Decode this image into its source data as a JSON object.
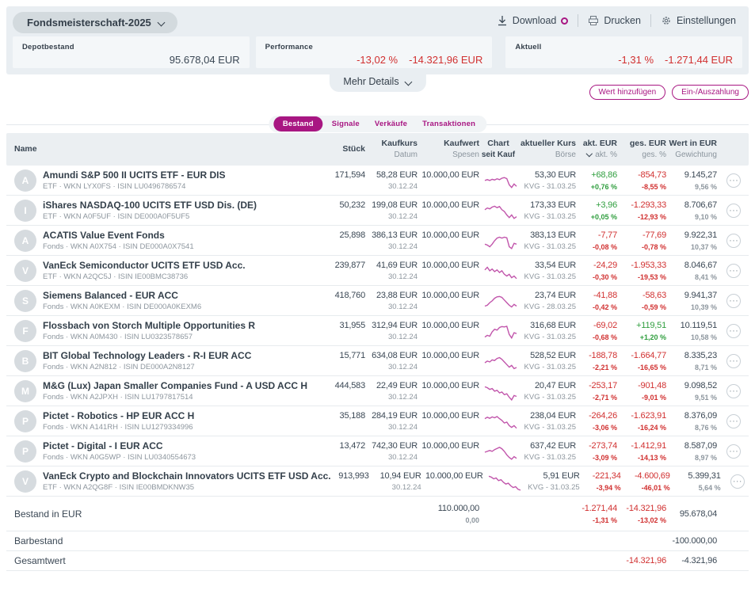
{
  "colors": {
    "brand": "#a81682",
    "red": "#d13030",
    "green": "#2f9e3e",
    "spark": "#c155ab"
  },
  "header": {
    "portfolio_selector": "Fondsmeisterschaft-2025",
    "actions": {
      "download": "Download",
      "print": "Drucken",
      "settings": "Einstellungen"
    },
    "cards": [
      {
        "label": "Depotbestand",
        "values": [
          {
            "text": "95.678,04 EUR",
            "tone": ""
          }
        ]
      },
      {
        "label": "Performance",
        "values": [
          {
            "text": "-13,02 %",
            "tone": "neg"
          },
          {
            "text": "-14.321,96 EUR",
            "tone": "neg"
          }
        ]
      },
      {
        "label": "Aktuell",
        "values": [
          {
            "text": "-1,31 %",
            "tone": "neg"
          },
          {
            "text": "-1.271,44 EUR",
            "tone": "neg"
          }
        ]
      }
    ],
    "more_details": "Mehr Details"
  },
  "toolbar": {
    "add_value": "Wert hinzufügen",
    "deposit": "Ein-/Auszahlung"
  },
  "tabs": [
    {
      "label": "Bestand",
      "active": true
    },
    {
      "label": "Signale",
      "active": false
    },
    {
      "label": "Verkäufe",
      "active": false
    },
    {
      "label": "Transaktionen",
      "active": false
    }
  ],
  "table": {
    "columns": [
      {
        "id": "name",
        "l1": "Name",
        "l2": "",
        "align": "left"
      },
      {
        "id": "stueck",
        "l1": "Stück",
        "l2": "",
        "align": "right"
      },
      {
        "id": "kaufkurs",
        "l1": "Kaufkurs",
        "l2": "Datum",
        "align": "right"
      },
      {
        "id": "kaufwert",
        "l1": "Kaufwert",
        "l2": "Spesen",
        "align": "right"
      },
      {
        "id": "chart",
        "l1": "Chart",
        "l2": "seit Kauf",
        "align": "center",
        "bold2": true
      },
      {
        "id": "kurs",
        "l1": "aktueller Kurs",
        "l2": "Börse",
        "align": "right"
      },
      {
        "id": "akt",
        "l1": "akt. EUR",
        "l2": "akt. %",
        "align": "right",
        "sort": true
      },
      {
        "id": "ges",
        "l1": "ges. EUR",
        "l2": "ges. %",
        "align": "right"
      },
      {
        "id": "wert",
        "l1": "Wert in EUR",
        "l2": "Gewichtung",
        "align": "right"
      },
      {
        "id": "opts",
        "l1": "",
        "l2": "",
        "align": "center"
      }
    ],
    "rows": [
      {
        "initial": "A",
        "name": "Amundi S&P 500 II UCITS ETF - EUR DIS",
        "sub": "ETF · WKN LYX0FS · ISIN LU0496786574",
        "stueck": "171,594",
        "kaufkurs": "58,28 EUR",
        "datum": "30.12.24",
        "kaufwert": "10.000,00 EUR",
        "kurs": "53,30 EUR",
        "boerse": "KVG - 31.03.25",
        "akt": [
          "+68,86",
          "+0,76 %",
          "pos"
        ],
        "ges": [
          "-854,73",
          "-8,55 %",
          "neg"
        ],
        "wert": [
          "9.145,27",
          "9,56 %"
        ],
        "spark": [
          0.55,
          0.6,
          0.55,
          0.62,
          0.58,
          0.65,
          0.6,
          0.68,
          0.72,
          0.66,
          0.3,
          0.15,
          0.35,
          0.22
        ]
      },
      {
        "initial": "I",
        "name": "iShares NASDAQ-100 UCITS ETF USD Dis. (DE)",
        "sub": "ETF · WKN A0F5UF · ISIN DE000A0F5UF5",
        "stueck": "50,232",
        "kaufkurs": "199,08 EUR",
        "datum": "30.12.24",
        "kaufwert": "10.000,00 EUR",
        "kurs": "173,33 EUR",
        "boerse": "KVG - 31.03.25",
        "akt": [
          "+3,96",
          "+0,05 %",
          "pos"
        ],
        "ges": [
          "-1.293,33",
          "-12,93 %",
          "neg"
        ],
        "wert": [
          "8.706,67",
          "9,10 %"
        ],
        "spark": [
          0.6,
          0.7,
          0.65,
          0.75,
          0.8,
          0.72,
          0.78,
          0.6,
          0.5,
          0.3,
          0.15,
          0.3,
          0.1,
          0.2
        ]
      },
      {
        "initial": "A",
        "name": "ACATIS Value Event Fonds",
        "sub": "Fonds · WKN A0X754 · ISIN DE000A0X7541",
        "stueck": "25,898",
        "kaufkurs": "386,13 EUR",
        "datum": "30.12.24",
        "kaufwert": "10.000,00 EUR",
        "kurs": "383,13 EUR",
        "boerse": "KVG - 31.03.25",
        "akt": [
          "-7,77",
          "-0,08 %",
          "neg"
        ],
        "ges": [
          "-77,69",
          "-0,78 %",
          "neg"
        ],
        "wert": [
          "9.922,31",
          "10,37 %"
        ],
        "spark": [
          0.35,
          0.3,
          0.2,
          0.35,
          0.55,
          0.7,
          0.75,
          0.7,
          0.75,
          0.72,
          0.2,
          0.1,
          0.4,
          0.35
        ]
      },
      {
        "initial": "V",
        "name": "VanEck Semiconductor UCITS ETF USD Acc.",
        "sub": "ETF · WKN A2QC5J · ISIN IE00BMC38736",
        "stueck": "239,877",
        "kaufkurs": "41,69 EUR",
        "datum": "30.12.24",
        "kaufwert": "10.000,00 EUR",
        "kurs": "33,54 EUR",
        "boerse": "KVG - 31.03.25",
        "akt": [
          "-24,29",
          "-0,30 %",
          "neg"
        ],
        "ges": [
          "-1.953,33",
          "-19,53 %",
          "neg"
        ],
        "wert": [
          "8.046,67",
          "8,41 %"
        ],
        "spark": [
          0.6,
          0.75,
          0.55,
          0.65,
          0.5,
          0.6,
          0.45,
          0.55,
          0.35,
          0.25,
          0.35,
          0.15,
          0.25,
          0.1
        ]
      },
      {
        "initial": "S",
        "name": "Siemens Balanced - EUR ACC",
        "sub": "Fonds · WKN A0KEXM · ISIN DE000A0KEXM6",
        "stueck": "418,760",
        "kaufkurs": "23,88 EUR",
        "datum": "30.12.24",
        "kaufwert": "10.000,00 EUR",
        "kurs": "23,74 EUR",
        "boerse": "KVG - 28.03.25",
        "akt": [
          "-41,88",
          "-0,42 %",
          "neg"
        ],
        "ges": [
          "-58,63",
          "-0,59 %",
          "neg"
        ],
        "wert": [
          "9.941,37",
          "10,39 %"
        ],
        "spark": [
          0.25,
          0.3,
          0.45,
          0.55,
          0.7,
          0.78,
          0.8,
          0.75,
          0.6,
          0.45,
          0.3,
          0.2,
          0.35,
          0.25
        ]
      },
      {
        "initial": "F",
        "name": "Flossbach von Storch Multiple Opportunities R",
        "sub": "Fonds · WKN A0M430 · ISIN LU0323578657",
        "stueck": "31,955",
        "kaufkurs": "312,94 EUR",
        "datum": "30.12.24",
        "kaufwert": "10.000,00 EUR",
        "kurs": "316,68 EUR",
        "boerse": "KVG - 31.03.25",
        "akt": [
          "-69,02",
          "-0,68 %",
          "neg"
        ],
        "ges": [
          "+119,51",
          "+1,20 %",
          "pos"
        ],
        "wert": [
          "10.119,51",
          "10,58 %"
        ],
        "spark": [
          0.2,
          0.3,
          0.25,
          0.5,
          0.65,
          0.6,
          0.75,
          0.8,
          0.78,
          0.82,
          0.35,
          0.15,
          0.45,
          0.4
        ]
      },
      {
        "initial": "B",
        "name": "BIT Global Technology Leaders - R-I EUR ACC",
        "sub": "Fonds · WKN A2N812 · ISIN DE000A2N8127",
        "stueck": "15,771",
        "kaufkurs": "634,08 EUR",
        "datum": "30.12.24",
        "kaufwert": "10.000,00 EUR",
        "kurs": "528,52 EUR",
        "boerse": "KVG - 31.03.25",
        "akt": [
          "-188,78",
          "-2,21 %",
          "neg"
        ],
        "ges": [
          "-1.664,77",
          "-16,65 %",
          "neg"
        ],
        "wert": [
          "8.335,23",
          "8,71 %"
        ],
        "spark": [
          0.45,
          0.55,
          0.5,
          0.62,
          0.58,
          0.7,
          0.75,
          0.65,
          0.5,
          0.35,
          0.2,
          0.3,
          0.12,
          0.18
        ]
      },
      {
        "initial": "M",
        "name": "M&G (Lux) Japan Smaller Companies Fund - A USD ACC H",
        "sub": "Fonds · WKN A2JPXH · ISIN LU1797817514",
        "stueck": "444,583",
        "kaufkurs": "22,49 EUR",
        "datum": "30.12.24",
        "kaufwert": "10.000,00 EUR",
        "kurs": "20,47 EUR",
        "boerse": "KVG - 31.03.25",
        "akt": [
          "-253,17",
          "-2,71 %",
          "neg"
        ],
        "ges": [
          "-901,48",
          "-9,01 %",
          "neg"
        ],
        "wert": [
          "9.098,52",
          "9,51 %"
        ],
        "spark": [
          0.8,
          0.75,
          0.65,
          0.7,
          0.55,
          0.6,
          0.45,
          0.5,
          0.35,
          0.4,
          0.2,
          0.05,
          0.3,
          0.25
        ]
      },
      {
        "initial": "P",
        "name": "Pictet - Robotics - HP EUR ACC H",
        "sub": "Fonds · WKN A141RH · ISIN LU1279334996",
        "stueck": "35,188",
        "kaufkurs": "284,19 EUR",
        "datum": "30.12.24",
        "kaufwert": "10.000,00 EUR",
        "kurs": "238,04 EUR",
        "boerse": "KVG - 31.03.25",
        "akt": [
          "-264,26",
          "-3,06 %",
          "neg"
        ],
        "ges": [
          "-1.623,91",
          "-16,24 %",
          "neg"
        ],
        "wert": [
          "8.376,09",
          "8,76 %"
        ],
        "spark": [
          0.7,
          0.78,
          0.72,
          0.8,
          0.75,
          0.82,
          0.7,
          0.6,
          0.45,
          0.5,
          0.3,
          0.2,
          0.3,
          0.15
        ]
      },
      {
        "initial": "P",
        "name": "Pictet - Digital - I EUR ACC",
        "sub": "Fonds · WKN A0G5WP · ISIN LU0340554673",
        "stueck": "13,472",
        "kaufkurs": "742,30 EUR",
        "datum": "30.12.24",
        "kaufwert": "10.000,00 EUR",
        "kurs": "637,42 EUR",
        "boerse": "KVG - 31.03.25",
        "akt": [
          "-273,74",
          "-3,09 %",
          "neg"
        ],
        "ges": [
          "-1.412,91",
          "-14,13 %",
          "neg"
        ],
        "wert": [
          "8.587,09",
          "8,97 %"
        ],
        "spark": [
          0.5,
          0.55,
          0.6,
          0.55,
          0.65,
          0.72,
          0.78,
          0.7,
          0.55,
          0.35,
          0.2,
          0.1,
          0.25,
          0.15
        ]
      },
      {
        "initial": "V",
        "name": "VanEck Crypto and Blockchain Innovators UCITS ETF USD Acc.",
        "sub": "ETF · WKN A2QG8F · ISIN IE00BMDKNW35",
        "stueck": "913,993",
        "kaufkurs": "10,94 EUR",
        "datum": "30.12.24",
        "kaufwert": "10.000,00 EUR",
        "kurs": "5,91 EUR",
        "boerse": "KVG - 31.03.25",
        "akt": [
          "-221,34",
          "-3,94 %",
          "neg"
        ],
        "ges": [
          "-4.600,69",
          "-46,01 %",
          "neg"
        ],
        "wert": [
          "5.399,31",
          "5,64 %"
        ],
        "spark": [
          0.85,
          0.8,
          0.7,
          0.75,
          0.6,
          0.65,
          0.5,
          0.4,
          0.45,
          0.3,
          0.2,
          0.25,
          0.1,
          0.05
        ]
      }
    ],
    "footer": [
      {
        "label": "Bestand in EUR",
        "kaufwert": "110.000,00",
        "spesen": "0,00",
        "akt": [
          "-1.271,44",
          "-1,31 %",
          "neg"
        ],
        "ges": [
          "-14.321,96",
          "-13,02 %",
          "neg"
        ],
        "wert": "95.678,04",
        "tall": true
      },
      {
        "label": "Barbestand",
        "wert": "-100.000,00"
      },
      {
        "label": "Gesamtwert",
        "ges": [
          "-14.321,96",
          "",
          "neg"
        ],
        "wert": "-4.321,96"
      }
    ]
  }
}
